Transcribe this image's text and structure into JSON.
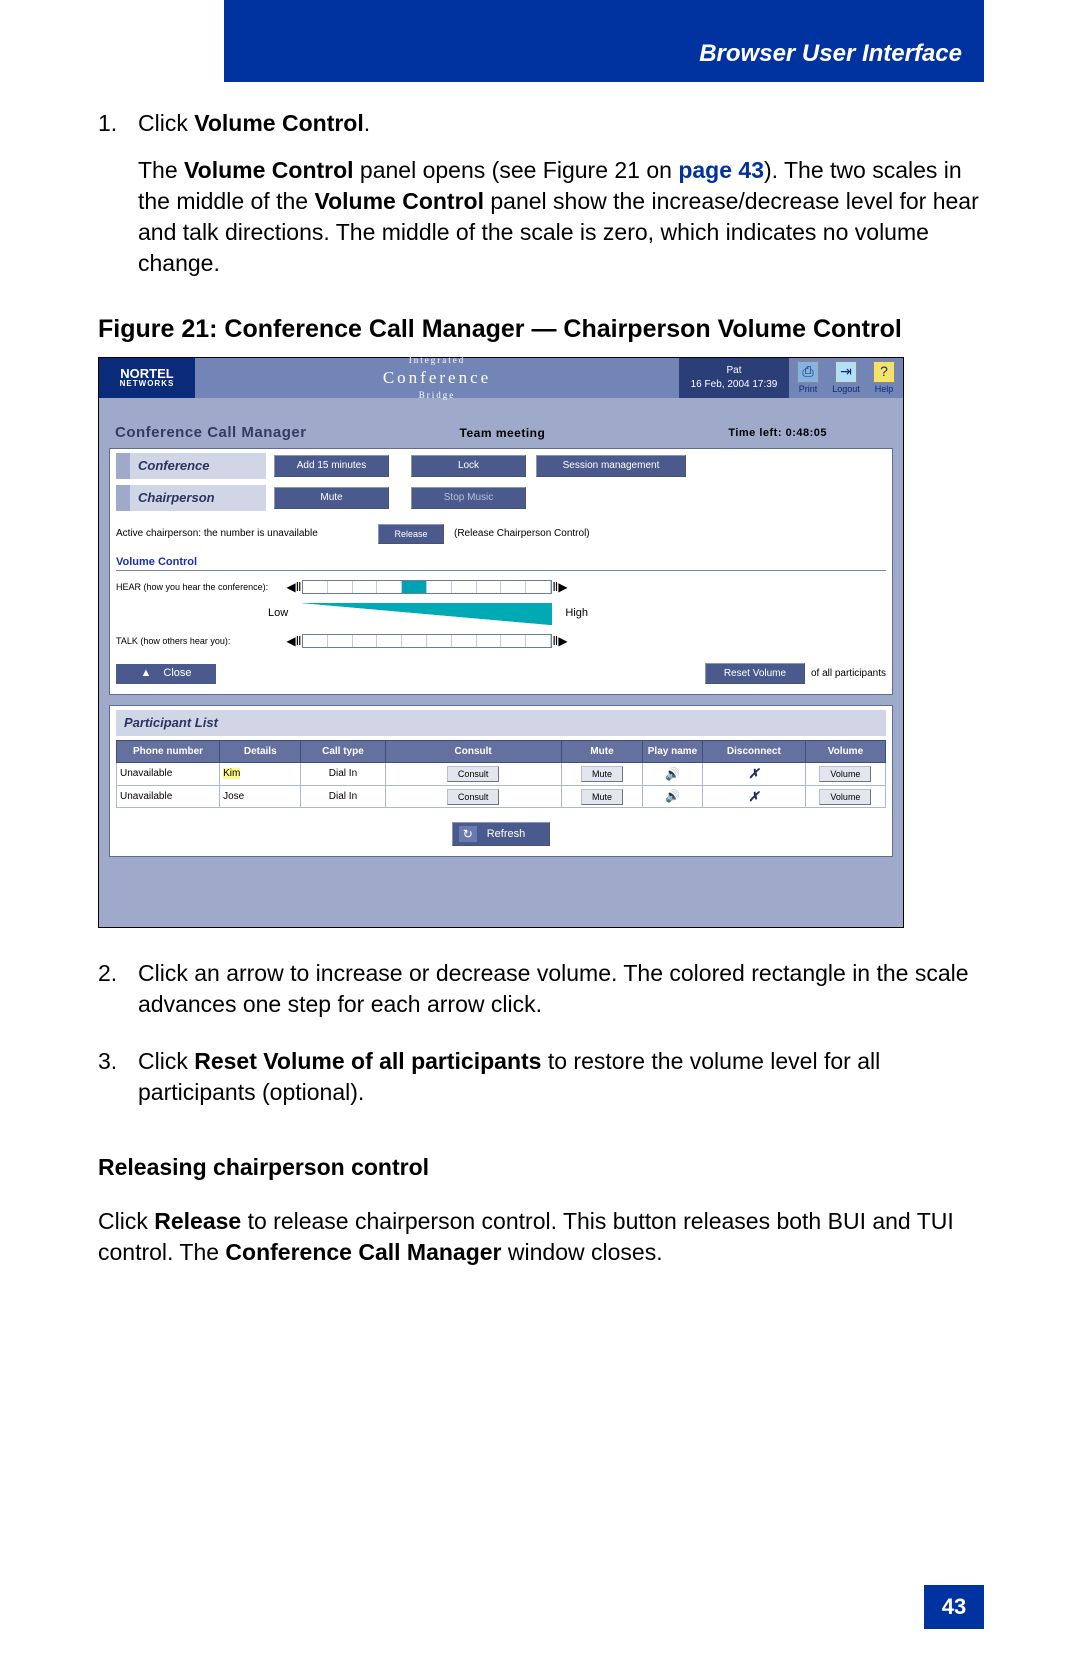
{
  "header": {
    "section_title": "Browser User Interface"
  },
  "steps": {
    "s1_num": "1.",
    "s1a_pre": "Click ",
    "s1a_bold": "Volume Control",
    "s1a_post": ".",
    "s1b_1": "The ",
    "s1b_b1": "Volume Control",
    "s1b_2": " panel opens (see Figure 21 on ",
    "s1b_link": "page 43",
    "s1b_3": "). The two scales in the middle of the ",
    "s1b_b2": "Volume Control",
    "s1b_4": " panel show the increase/decrease level for hear and talk directions. The middle of the scale is zero, which indicates no volume change."
  },
  "figure_caption": "Figure 21: Conference Call Manager — Chairperson Volume Control",
  "ss": {
    "logo_top": "NORTEL",
    "logo_bot": "NETWORKS",
    "title_top": "Integrated",
    "title_mid": "Conference",
    "title_bot": "Bridge",
    "user_name": "Pat",
    "user_time": "16 Feb, 2004 17:39",
    "btn_print": "Print",
    "btn_logout": "Logout",
    "btn_help": "Help",
    "ccm": "Conference Call Manager",
    "meeting": "Team meeting",
    "time_left_label": "Time left:",
    "time_left": "0:48:05",
    "row_conference": "Conference",
    "btn_add15": "Add 15 minutes",
    "btn_lock": "Lock",
    "btn_session": "Session management",
    "row_chair": "Chairperson",
    "btn_mute": "Mute",
    "btn_stop_music": "Stop Music",
    "chair_note": "Active chairperson: the number is unavailable",
    "btn_release": "Release",
    "release_note": "(Release Chairperson Control)",
    "vol_title": "Volume Control",
    "hear_label": "HEAR (how you hear the conference):",
    "talk_label": "TALK (how others hear you):",
    "low": "Low",
    "high": "High",
    "close": "Close",
    "reset_btn": "Reset Volume",
    "reset_txt": "of all participants",
    "plist": "Participant List",
    "cols": {
      "phone": "Phone number",
      "details": "Details",
      "calltype": "Call type",
      "consult": "Consult",
      "mute": "Mute",
      "play": "Play name",
      "disc": "Disconnect",
      "vol": "Volume"
    },
    "rows": [
      {
        "phone": "Unavailable",
        "details": "Kim",
        "calltype": "Dial In",
        "consult": "Consult",
        "mute": "Mute",
        "vol": "Volume"
      },
      {
        "phone": "Unavailable",
        "details": "Jose",
        "calltype": "Dial In",
        "consult": "Consult",
        "mute": "Mute",
        "vol": "Volume"
      }
    ],
    "refresh": "Refresh"
  },
  "after": {
    "s2_num": "2.",
    "s2": "Click an arrow to increase or decrease volume. The colored rectangle in the scale advances one step for each arrow click.",
    "s3_num": "3.",
    "s3_1": "Click ",
    "s3_b": "Reset Volume of all participants",
    "s3_2": " to restore the volume level for all participants (optional).",
    "sub": "Releasing chairperson control",
    "p_1": "Click ",
    "p_b1": "Release",
    "p_2": " to release chairperson control. This button releases both BUI and TUI control. The ",
    "p_b2": "Conference Call Manager",
    "p_3": " window closes."
  },
  "page_number": "43"
}
